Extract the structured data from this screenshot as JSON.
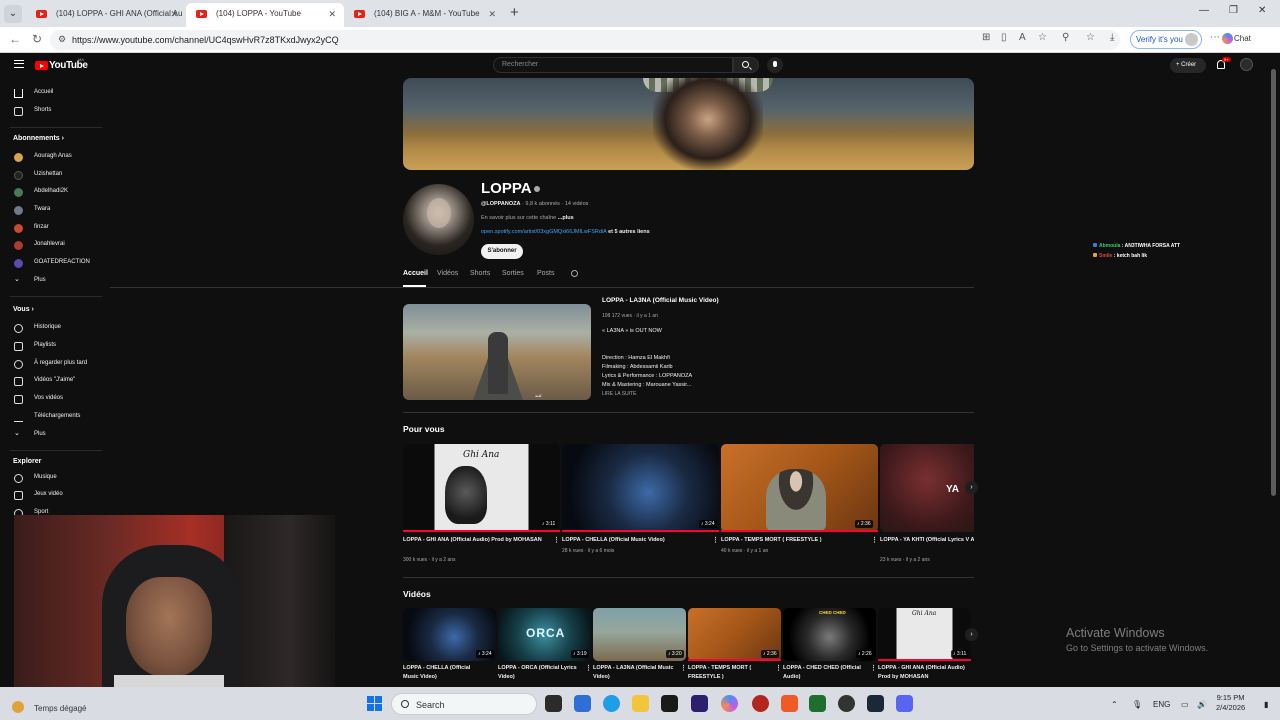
{
  "browser": {
    "tabs": [
      {
        "title": "(104) LOPPA - GHI ANA (Official Au"
      },
      {
        "title": "(104) LOPPA - YouTube"
      },
      {
        "title": "(104) BIG A - M&M - YouTube"
      }
    ],
    "url": "https://www.youtube.com/channel/UC4qswHvR7z8TKxdJwyx2yCQ",
    "verify_label": "Verify it's you",
    "chat_label": "Chat"
  },
  "masthead": {
    "logo": "YouTube",
    "country": "MA",
    "search_placeholder": "Rechercher",
    "create_label": "Créer",
    "notif_count": "9+"
  },
  "sidebar": {
    "main": [
      {
        "label": "Accueil",
        "icon": "home-icon"
      },
      {
        "label": "Shorts",
        "icon": "shorts-icon"
      }
    ],
    "subs_heading": "Abonnements",
    "subs": [
      {
        "label": "Aouragh Anas",
        "color": "#d9a441"
      },
      {
        "label": "Uzishettan",
        "color": "#222222"
      },
      {
        "label": "Abdelhadi2K",
        "color": "#4a7a5a"
      },
      {
        "label": "Twara",
        "color": "#6f7b8a"
      },
      {
        "label": "finzar",
        "color": "#c84a2f"
      },
      {
        "label": "Jonahlevrai",
        "color": "#b03a2e"
      },
      {
        "label": "GOATEDREACTION",
        "color": "#5b4ab0"
      },
      {
        "label": "Plus"
      }
    ],
    "you_heading": "Vous",
    "you": [
      {
        "label": "Historique",
        "icon": "history-icon"
      },
      {
        "label": "Playlists",
        "icon": "playlists-icon"
      },
      {
        "label": "À regarder plus tard",
        "icon": "watch-later-icon"
      },
      {
        "label": "Vidéos \"J'aime\"",
        "icon": "like-icon"
      },
      {
        "label": "Vos vidéos",
        "icon": "your-videos-icon"
      },
      {
        "label": "Téléchargements",
        "icon": "downloads-icon"
      },
      {
        "label": "Plus"
      }
    ],
    "explore_heading": "Explorer",
    "explore": [
      {
        "label": "Musique",
        "icon": "music-icon"
      },
      {
        "label": "Jeux vidéo",
        "icon": "gaming-icon"
      },
      {
        "label": "Sport",
        "icon": "sport-icon"
      }
    ]
  },
  "channel": {
    "name": "LOPPA",
    "handle": "@LOPPANOZA",
    "subs": "9,8 k abonnés",
    "videos": "14 vidéos",
    "desc_prefix": "En savoir plus sur cette chaîne",
    "desc_more": "...plus",
    "link": "open.spotify.com/artist/03xgGMQxi66JMlLwFSRdiA",
    "link_more": "et 5 autres liens",
    "subscribe": "S'abonner",
    "tabs": [
      "Accueil",
      "Vidéos",
      "Shorts",
      "Sorties",
      "Posts"
    ]
  },
  "featured": {
    "title": "LOPPA - LA3NA (Official Music Video)",
    "meta": "108 172 vues · il y a 1 an",
    "tagline": "« LA3NA » is OUT NOW",
    "credits": [
      "Direction : Hamza El Makhfi",
      "Filmaking : Abdessamii Karib",
      "Lyrics & Performance : LOPPANOZA",
      "Mix & Mastering : Marouane Yassir..."
    ],
    "read_more": "LIRE LA SUITE",
    "thumb_sig": "لعنة"
  },
  "pour_vous": {
    "title": "Pour vous",
    "items": [
      {
        "title": "LOPPA - GHI ANA (Official Audio) Prod by MOHASAN",
        "views": "300 k vues",
        "age": "il y a 2 ans",
        "duration": "♪ 3:11",
        "overlay": "Ghi Ana"
      },
      {
        "title": "LOPPA - CHELLA (Official Music Video)",
        "views": "28 k vues",
        "age": "il y a 6 mois",
        "duration": "♪ 3:24"
      },
      {
        "title": "LOPPA - TEMPS MORT ( FREESTYLE )",
        "views": "40 k vues",
        "age": "il y a 1 an",
        "duration": "♪ 2:36"
      },
      {
        "title": "LOPPA - YA KHTI (Official Lyrics V Ayabeats",
        "views": "23 k vues",
        "age": "il y a 2 ans",
        "overlay": "YA"
      }
    ]
  },
  "videos": {
    "title": "Vidéos",
    "items": [
      {
        "title": "LOPPA - CHELLA (Official Music Video)",
        "duration": "♪ 3:24"
      },
      {
        "title": "LOPPA - ORCA (Official Lyrics Video)",
        "duration": "♪ 3:19",
        "overlay": "ORCA"
      },
      {
        "title": "LOPPA - LA3NA (Official Music Video)",
        "duration": "♪ 3:20"
      },
      {
        "title": "LOPPA - TEMPS MORT ( FREESTYLE )",
        "duration": "♪ 2:36"
      },
      {
        "title": "LOPPA - CHED CHED (Official Audio)",
        "duration": "♪ 2:26",
        "overlay": "CHED CHED"
      },
      {
        "title": "LOPPA - GHI ANA (Official Audio) Prod by MOHASAN",
        "duration": "♪ 3:11",
        "overlay": "Ghi Ana"
      }
    ]
  },
  "chat_overlay": [
    {
      "user": "Abmoula",
      "message": " : AN3TIWHA FORSA ATT",
      "color": "#3ec96a"
    },
    {
      "user": "Smile",
      "message": " : ketch bah lik",
      "color": "#e0462e"
    }
  ],
  "windows_activation": {
    "title": "Activate Windows",
    "subtitle": "Go to Settings to activate Windows."
  },
  "taskbar": {
    "weather": "Temps dégagé",
    "search": "Search",
    "lang": "ENG",
    "time": "9:15 PM",
    "date": "2/4/2026"
  }
}
